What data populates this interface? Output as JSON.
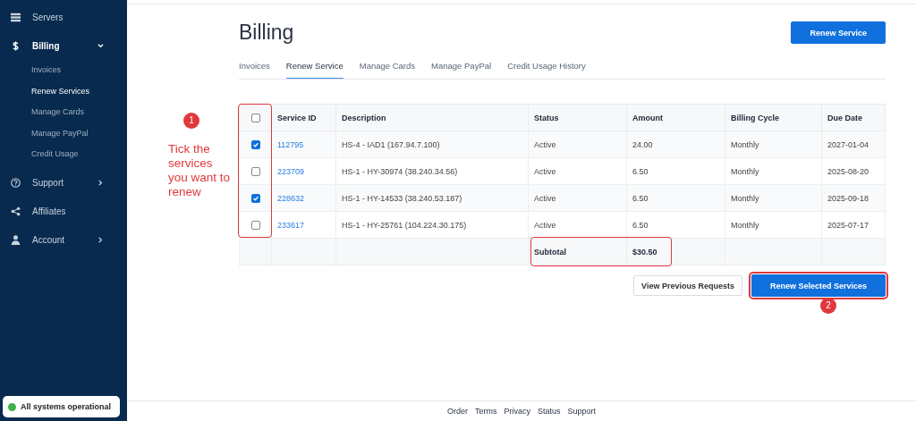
{
  "sidebar": {
    "items": [
      {
        "label": "Servers",
        "selected": false
      },
      {
        "label": "Billing",
        "selected": true,
        "expanded": true,
        "children": [
          {
            "label": "Invoices",
            "selected": false
          },
          {
            "label": "Renew Services",
            "selected": true
          },
          {
            "label": "Manage Cards",
            "selected": false
          },
          {
            "label": "Manage PayPal",
            "selected": false
          },
          {
            "label": "Credit Usage",
            "selected": false
          }
        ]
      },
      {
        "label": "Support",
        "selected": false,
        "expanded": false
      },
      {
        "label": "Affiliates",
        "selected": false
      },
      {
        "label": "Account",
        "selected": false,
        "expanded": false
      }
    ],
    "status": {
      "text": "All systems operational",
      "color": "#3cb34a"
    }
  },
  "page": {
    "title": "Billing",
    "action": "Renew Service"
  },
  "tabs": [
    {
      "label": "Invoices",
      "selected": false
    },
    {
      "label": "Renew Service",
      "selected": true
    },
    {
      "label": "Manage Cards",
      "selected": false
    },
    {
      "label": "Manage PayPal",
      "selected": false
    },
    {
      "label": "Credit Usage History",
      "selected": false
    }
  ],
  "table": {
    "select_all_checked": false,
    "select_column_highlighted": true,
    "columns": [
      "Service ID",
      "Description",
      "Status",
      "Amount",
      "Billing Cycle",
      "Due Date"
    ],
    "rows": [
      {
        "checked": true,
        "id": "112795",
        "description": "HS-4 - IAD1 (167.94.7.100)",
        "status": "Active",
        "amount": "24.00",
        "cycle": "Monthly",
        "due": "2027-01-04"
      },
      {
        "checked": false,
        "id": "223709",
        "description": "HS-1 - HY-30974 (38.240.34.56)",
        "status": "Active",
        "amount": "6.50",
        "cycle": "Monthly",
        "due": "2025-08-20"
      },
      {
        "checked": true,
        "id": "228632",
        "description": "HS-1 - HY-14533 (38.240.53.187)",
        "status": "Active",
        "amount": "6.50",
        "cycle": "Monthly",
        "due": "2025-09-18"
      },
      {
        "checked": false,
        "id": "233617",
        "description": "HS-1 - HY-25761 (104.224.30.175)",
        "status": "Active",
        "amount": "6.50",
        "cycle": "Monthly",
        "due": "2025-07-17"
      }
    ],
    "subtotal": {
      "label": "Subtotal",
      "value": "$30.50",
      "highlighted": true
    }
  },
  "buttons": [
    {
      "label": "View Previous Requests",
      "kind": "secondary",
      "highlighted": false
    },
    {
      "label": "Renew Selected Services",
      "kind": "primary",
      "highlighted": true
    }
  ],
  "annotations": [
    {
      "kind": "marker",
      "label": "1"
    },
    {
      "kind": "note",
      "text": "Tick the services you want to renew"
    },
    {
      "kind": "marker",
      "label": "2"
    }
  ],
  "footer": {
    "links": [
      "Order",
      "Terms",
      "Privacy",
      "Status",
      "Support"
    ]
  }
}
